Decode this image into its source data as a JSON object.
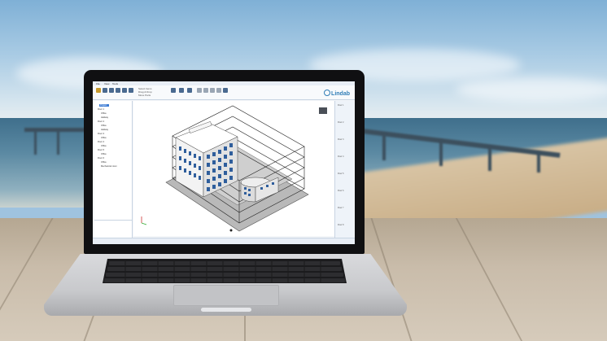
{
  "app": {
    "logo_text": "Lindab",
    "menu": [
      "File",
      "View",
      "Tools"
    ],
    "ribbon_labels": [
      "Select Items",
      "Drag & Drop",
      "Move Parts"
    ],
    "tree_items": [
      "Project",
      "Floor 1",
      "Office",
      "Hallway",
      "Floor 2",
      "Office",
      "Hallway",
      "Floor 3",
      "Office",
      "Floor 4",
      "Office",
      "Floor 5",
      "Office",
      "Floor 6",
      "Office",
      "Mechanical room"
    ],
    "right_panel_items": [
      "Floor 1",
      "Floor 2",
      "Floor 3",
      "Floor 4",
      "Floor 5",
      "Floor 6",
      "Floor 7",
      "Floor 8"
    ]
  },
  "colors": {
    "accent": "#2f7db6",
    "selection": "#3b7ad3"
  },
  "icons": [
    "laptop",
    "building-model",
    "lindab-logo"
  ]
}
